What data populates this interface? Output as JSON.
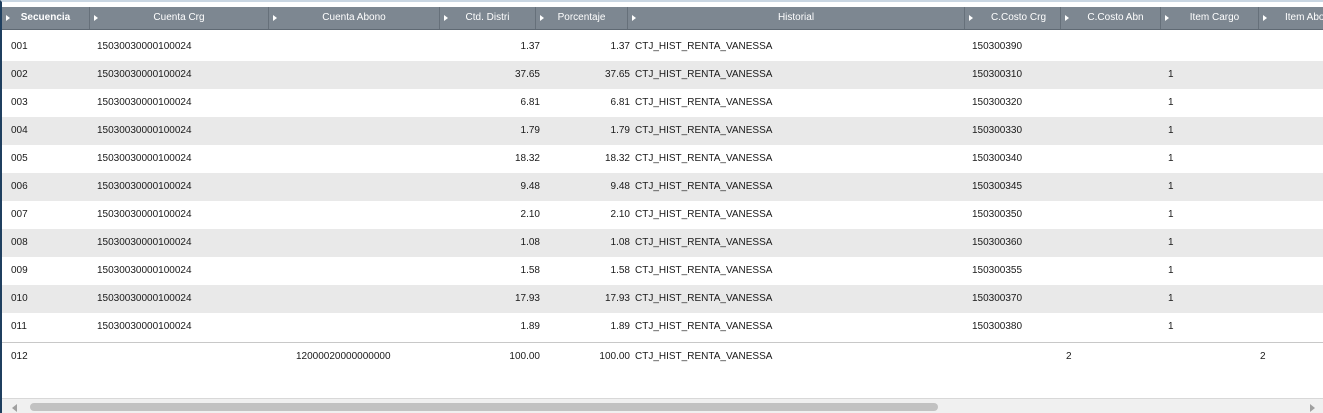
{
  "columns": [
    {
      "label": "Secuencia"
    },
    {
      "label": "Cuenta Crg"
    },
    {
      "label": "Cuenta Abono"
    },
    {
      "label": "Ctd. Distri"
    },
    {
      "label": "Porcentaje"
    },
    {
      "label": "Historial"
    },
    {
      "label": "C.Costo Crg"
    },
    {
      "label": "C.Costo Abn"
    },
    {
      "label": "Item Cargo"
    },
    {
      "label": "Item Abo"
    }
  ],
  "rows": [
    {
      "seq": "001",
      "cuenta_crg": "15030030000100024",
      "cuenta_abono": "",
      "ctd": "1.37",
      "pct": "1.37",
      "hist": "CTJ_HIST_RENTA_VANESSA",
      "cc_crg": "150300390",
      "cc_abn": "",
      "item_cargo": "",
      "item_abono": ""
    },
    {
      "seq": "002",
      "cuenta_crg": "15030030000100024",
      "cuenta_abono": "",
      "ctd": "37.65",
      "pct": "37.65",
      "hist": "CTJ_HIST_RENTA_VANESSA",
      "cc_crg": "150300310",
      "cc_abn": "",
      "item_cargo": "1",
      "item_abono": ""
    },
    {
      "seq": "003",
      "cuenta_crg": "15030030000100024",
      "cuenta_abono": "",
      "ctd": "6.81",
      "pct": "6.81",
      "hist": "CTJ_HIST_RENTA_VANESSA",
      "cc_crg": "150300320",
      "cc_abn": "",
      "item_cargo": "1",
      "item_abono": ""
    },
    {
      "seq": "004",
      "cuenta_crg": "15030030000100024",
      "cuenta_abono": "",
      "ctd": "1.79",
      "pct": "1.79",
      "hist": "CTJ_HIST_RENTA_VANESSA",
      "cc_crg": "150300330",
      "cc_abn": "",
      "item_cargo": "1",
      "item_abono": ""
    },
    {
      "seq": "005",
      "cuenta_crg": "15030030000100024",
      "cuenta_abono": "",
      "ctd": "18.32",
      "pct": "18.32",
      "hist": "CTJ_HIST_RENTA_VANESSA",
      "cc_crg": "150300340",
      "cc_abn": "",
      "item_cargo": "1",
      "item_abono": ""
    },
    {
      "seq": "006",
      "cuenta_crg": "15030030000100024",
      "cuenta_abono": "",
      "ctd": "9.48",
      "pct": "9.48",
      "hist": "CTJ_HIST_RENTA_VANESSA",
      "cc_crg": "150300345",
      "cc_abn": "",
      "item_cargo": "1",
      "item_abono": ""
    },
    {
      "seq": "007",
      "cuenta_crg": "15030030000100024",
      "cuenta_abono": "",
      "ctd": "2.10",
      "pct": "2.10",
      "hist": "CTJ_HIST_RENTA_VANESSA",
      "cc_crg": "150300350",
      "cc_abn": "",
      "item_cargo": "1",
      "item_abono": ""
    },
    {
      "seq": "008",
      "cuenta_crg": "15030030000100024",
      "cuenta_abono": "",
      "ctd": "1.08",
      "pct": "1.08",
      "hist": "CTJ_HIST_RENTA_VANESSA",
      "cc_crg": "150300360",
      "cc_abn": "",
      "item_cargo": "1",
      "item_abono": ""
    },
    {
      "seq": "009",
      "cuenta_crg": "15030030000100024",
      "cuenta_abono": "",
      "ctd": "1.58",
      "pct": "1.58",
      "hist": "CTJ_HIST_RENTA_VANESSA",
      "cc_crg": "150300355",
      "cc_abn": "",
      "item_cargo": "1",
      "item_abono": ""
    },
    {
      "seq": "010",
      "cuenta_crg": "15030030000100024",
      "cuenta_abono": "",
      "ctd": "17.93",
      "pct": "17.93",
      "hist": "CTJ_HIST_RENTA_VANESSA",
      "cc_crg": "150300370",
      "cc_abn": "",
      "item_cargo": "1",
      "item_abono": ""
    },
    {
      "seq": "011",
      "cuenta_crg": "15030030000100024",
      "cuenta_abono": "",
      "ctd": "1.89",
      "pct": "1.89",
      "hist": "CTJ_HIST_RENTA_VANESSA",
      "cc_crg": "150300380",
      "cc_abn": "",
      "item_cargo": "1",
      "item_abono": ""
    },
    {
      "seq": "012",
      "cuenta_crg": "",
      "cuenta_abono": "12000020000000000",
      "ctd": "100.00",
      "pct": "100.00",
      "hist": "CTJ_HIST_RENTA_VANESSA",
      "cc_crg": "",
      "cc_abn": "2",
      "item_cargo": "",
      "item_abono": "2"
    }
  ],
  "icons": {
    "header_arrow": "triangle-right-icon",
    "scroll_left": "triangle-left-icon",
    "scroll_right": "triangle-right-icon"
  },
  "colors": {
    "header_bg": "#7d8791",
    "row_alt": "#e9e9e9",
    "frame_border": "#1f3f5f"
  }
}
